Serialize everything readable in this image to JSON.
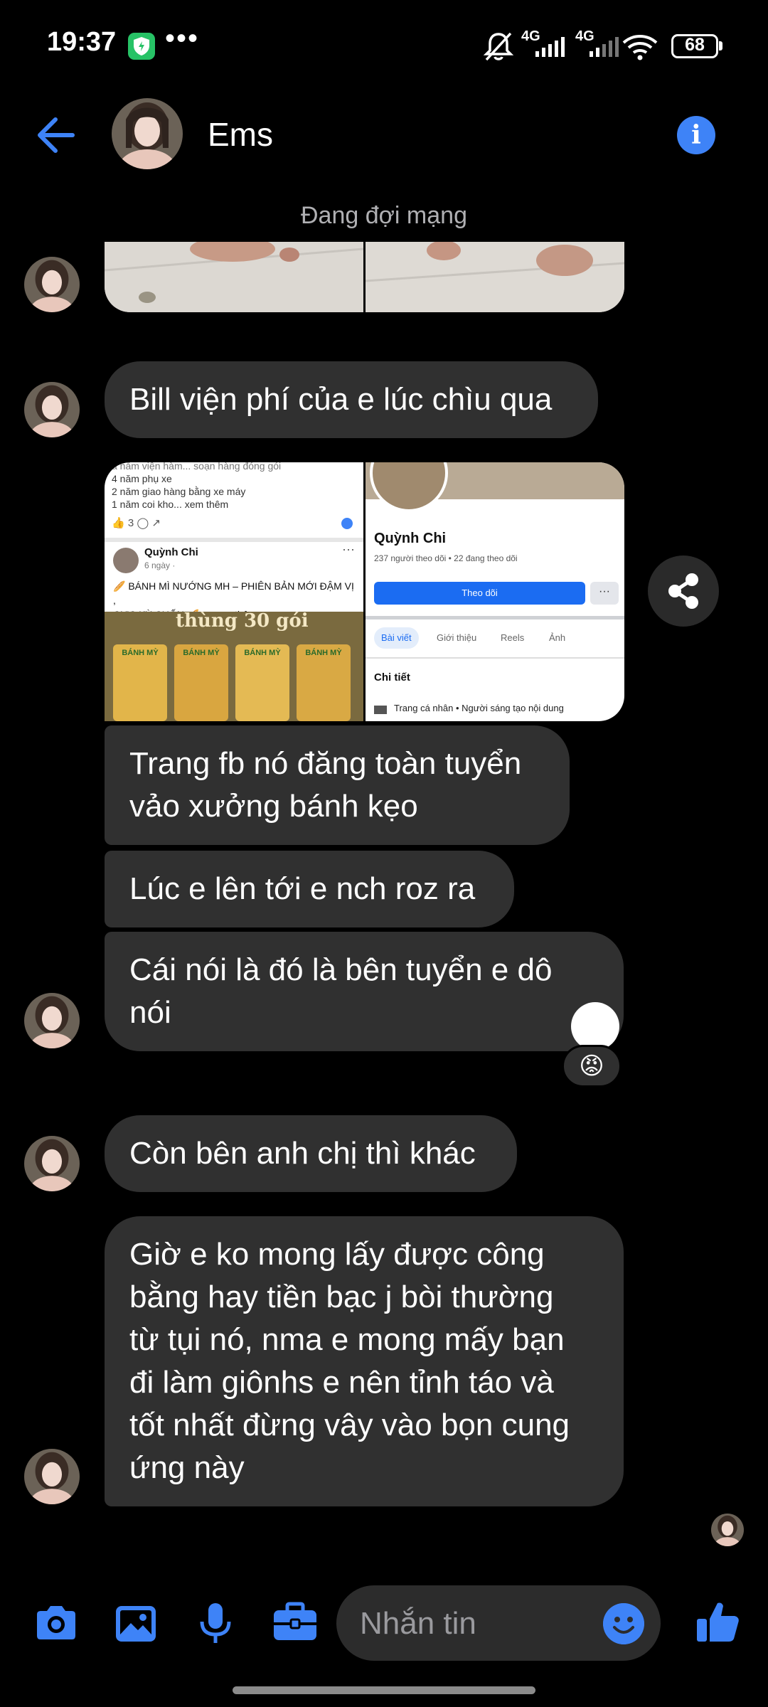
{
  "status_bar": {
    "time": "19:37",
    "network_1": "4G",
    "network_2": "4G",
    "battery": "68"
  },
  "header": {
    "contact_name": "Ems",
    "back_icon": "arrow-left-icon",
    "info_icon": "info-icon"
  },
  "network_status": "Đang đợi mạng",
  "messages": [
    {
      "id": "m1",
      "text": "Bill viện phí của e lúc chìu qua"
    },
    {
      "id": "m2",
      "lines": [
        "Trang fb nó đăng toàn tuyển",
        "vảo xưởng bánh kẹo"
      ]
    },
    {
      "id": "m3",
      "text": "Lúc e lên tới e nch roz ra"
    },
    {
      "id": "m4",
      "lines": [
        "Cái nói là đó là bên tuyển e dô",
        "nói"
      ]
    },
    {
      "id": "m5",
      "text": "Còn bên anh chị thì khác"
    },
    {
      "id": "m6",
      "lines": [
        "Giờ e ko mong lấy được công",
        "bằng hay tiền bạc j bòi thường",
        "từ tụi nó, nma e mong mấy bạn",
        "đi làm giônhs e nên tỉnh táo và",
        "tốt nhất đừng vây vào bọn cung",
        "ứng này"
      ]
    }
  ],
  "shared_post": {
    "post_lines": [
      "4 năm phụ xe",
      "2 năm giao hàng bằng xe máy",
      "1 năm coi kho... xem thêm"
    ],
    "author": "Quỳnh Chi",
    "post_time": "6 ngày ·",
    "post_caption_1": "🥖 BÁNH MÌ NƯỚNG MH – PHIÊN BẢN MỚI ĐẬM VỊ ,",
    "post_caption_2": "CỰC KỲ CUỐN 🥖 ... xem thêm",
    "banner": "thùng 30 gói",
    "bag_label": "BÁNH MỲ",
    "reaction_count": "3"
  },
  "profile_shot": {
    "name": "Quỳnh Chi",
    "followers": "237 người theo dõi • 22 đang theo dõi",
    "follow_button": "Theo dõi",
    "tabs": [
      "Bài viết",
      "Giới thiệu",
      "Reels",
      "Ảnh"
    ],
    "section_title": "Chi tiết",
    "detail_line": "Trang cá nhân • Người sáng tạo nội dung"
  },
  "reactions": {
    "big": "😡",
    "small": "😡"
  },
  "composer": {
    "placeholder": "Nhắn tin",
    "icons": [
      "camera-icon",
      "gallery-icon",
      "microphone-icon",
      "briefcase-icon",
      "emoji-icon",
      "thumbs-up-icon"
    ]
  },
  "colors": {
    "accent": "#3e83f7",
    "bubble": "#303030",
    "background": "#000000"
  }
}
